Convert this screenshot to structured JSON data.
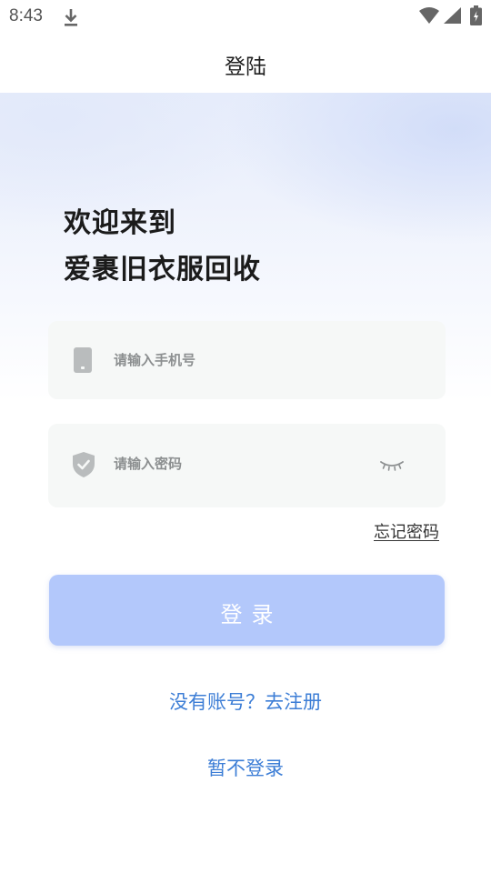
{
  "status_bar": {
    "time": "8:43",
    "icons": [
      "download-icon",
      "wifi-icon",
      "signal-icon",
      "battery-icon"
    ]
  },
  "header": {
    "title": "登陆"
  },
  "welcome": {
    "line1": "欢迎来到",
    "line2": "爱裹旧衣服回收"
  },
  "form": {
    "phone": {
      "icon": "phone-icon",
      "placeholder": "请输入手机号",
      "value": ""
    },
    "password": {
      "icon": "shield-icon",
      "placeholder": "请输入密码",
      "value": "",
      "toggle_icon": "eye-closed-icon"
    },
    "forgot_password": "忘记密码",
    "login_label": "登录"
  },
  "links": {
    "register": "没有账号？去注册",
    "skip_login": "暂不登录"
  },
  "colors": {
    "accent": "#3d7ed6",
    "login_button_disabled": "#b3c8fb",
    "field_background": "#f6f8f7",
    "icon_gray": "#b9bcbd"
  }
}
